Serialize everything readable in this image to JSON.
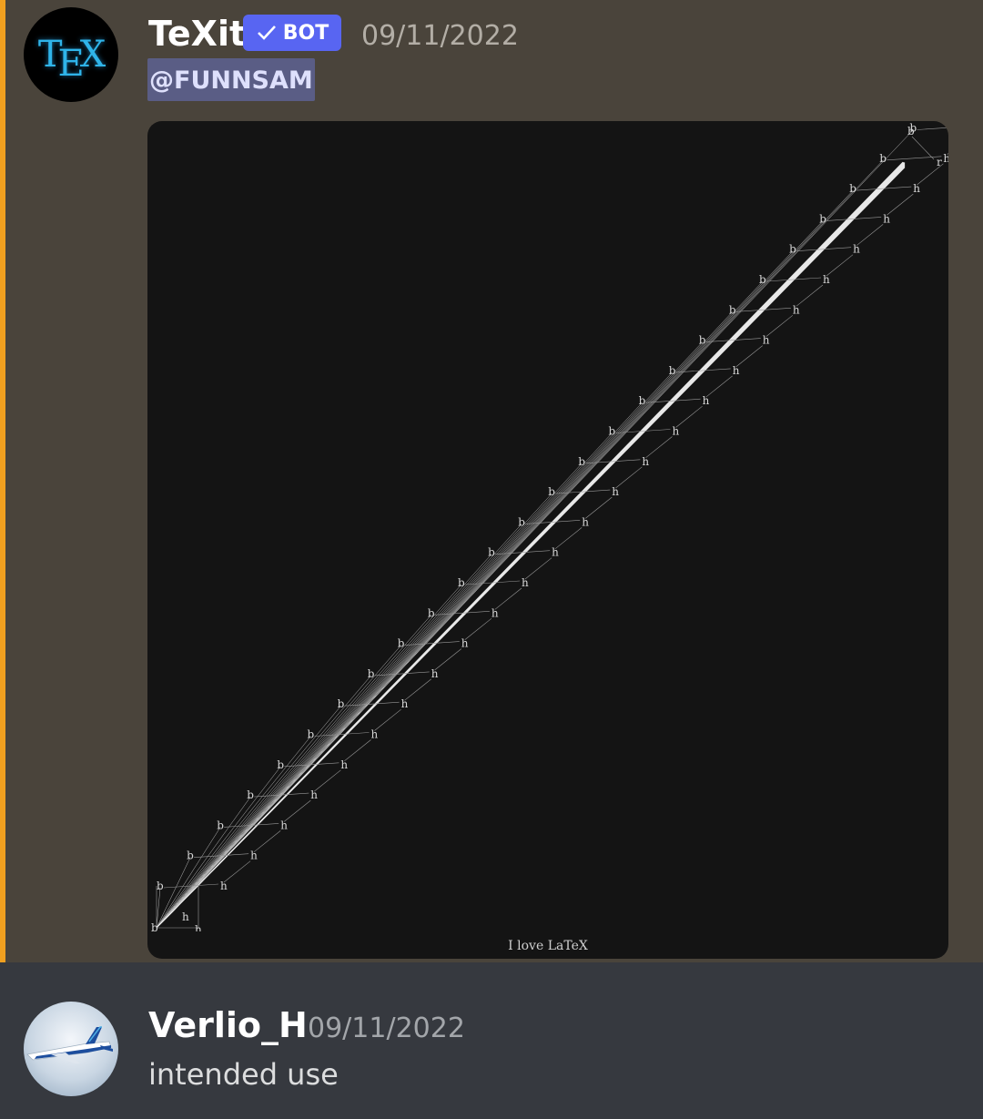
{
  "messages": [
    {
      "author": "TeXit",
      "badge": "BOT",
      "timestamp": "09/11/2022",
      "mention": "@FUNNSAM",
      "avatar_icon": "tex-logo-icon",
      "avatar_text": {
        "t": "T",
        "e": "E",
        "x": "X"
      },
      "image": {
        "caption": "I love LaTeX",
        "node_labels": {
          "upper": "b",
          "lower": "h",
          "end": "r"
        }
      },
      "highlight_color": "#f0a020"
    },
    {
      "author": "Verlio_H",
      "timestamp": "09/11/2022",
      "text": "intended use",
      "avatar_icon": "airplane-avatar-icon"
    }
  ]
}
